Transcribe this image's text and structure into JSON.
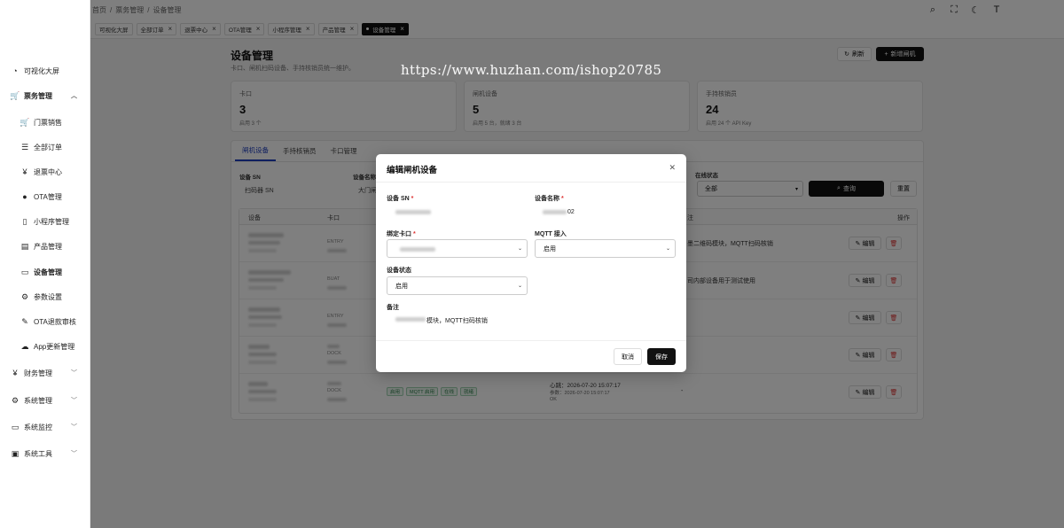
{
  "colors": {
    "accent": "#111111",
    "tab_active": "#1f3fbf",
    "badge_green": "#2e7d4a",
    "danger": "#dd3333"
  },
  "sidebar": {
    "items": [
      {
        "label": "可视化大屏",
        "icon": "dashboard-icon"
      },
      {
        "label": "票务管理",
        "icon": "cart-icon"
      },
      {
        "label": "门票销售",
        "icon": "cart-icon"
      },
      {
        "label": "全部订单",
        "icon": "list-icon"
      },
      {
        "label": "退票中心",
        "icon": "yen-icon"
      },
      {
        "label": "OTA管理",
        "icon": "globe-icon"
      },
      {
        "label": "小程序管理",
        "icon": "phone-icon"
      },
      {
        "label": "产品管理",
        "icon": "file-icon"
      },
      {
        "label": "设备管理",
        "icon": "monitor-icon"
      },
      {
        "label": "参数设置",
        "icon": "gear-icon"
      },
      {
        "label": "OTA退款审核",
        "icon": "edit-icon"
      },
      {
        "label": "App更新管理",
        "icon": "cloud-icon"
      },
      {
        "label": "财务管理",
        "icon": "yen-icon"
      },
      {
        "label": "系统管理",
        "icon": "gear-icon"
      },
      {
        "label": "系统监控",
        "icon": "monitor-icon"
      },
      {
        "label": "系统工具",
        "icon": "toolbox-icon"
      }
    ]
  },
  "breadcrumb": {
    "home": "首页",
    "section": "票务管理",
    "page": "设备管理"
  },
  "tabs": [
    "可视化大屏",
    "全部订单",
    "退票中心",
    "OTA管理",
    "小程序管理",
    "产品管理",
    "设备管理"
  ],
  "page": {
    "title": "设备管理",
    "subtitle": "卡口、闸机扫码设备、手持核销员统一维护。",
    "refresh_label": "刷新",
    "add_label": "新增闸机"
  },
  "stats": [
    {
      "label": "卡口",
      "value": "3",
      "hint": "启用 3 个"
    },
    {
      "label": "闸机设备",
      "value": "5",
      "hint": "启用 5 台，就绪 3 台"
    },
    {
      "label": "手持核销员",
      "value": "24",
      "hint": "启用 24 个 API Key"
    }
  ],
  "content_tabs": [
    "闸机设备",
    "手持核销员",
    "卡口管理"
  ],
  "filters": {
    "sn_label": "设备 SN",
    "sn_placeholder": "扫码器 SN",
    "name_label": "设备名称",
    "name_placeholder": "大门闸",
    "status_label": "在线状态",
    "status_value": "全部",
    "query_label": "查询",
    "reset_label": "重置"
  },
  "table": {
    "headers": [
      "设备",
      "卡口",
      "注",
      "操作"
    ],
    "rows": [
      {
        "gate_code": "ENTRY",
        "note": "墨二维码模块，MQTT扫码核销"
      },
      {
        "gate_code": "BUAT",
        "note": "司内部设备用于测试使用"
      },
      {
        "gate_code": "ENTRY",
        "note": ""
      },
      {
        "gate_code": "DOCK",
        "note": ""
      },
      {
        "gate_code": "DOCK",
        "note": "-",
        "badges": [
          "启用",
          "MQTT 启用",
          "在线",
          "就绪"
        ],
        "heartbeat": "心跳：2026-07-20 15:07:17",
        "param": "参数：2026-07-20 15:07:17",
        "param_status": "OK"
      }
    ],
    "edit_label": "编辑"
  },
  "watermark": "https://www.huzhan.com/ishop20785",
  "modal": {
    "title": "编辑闸机设备",
    "sn_label": "设备 SN",
    "name_label": "设备名称",
    "name_suffix": "02",
    "gate_label": "绑定卡口",
    "mqtt_label": "MQTT 接入",
    "mqtt_value": "启用",
    "status_label": "设备状态",
    "status_value": "启用",
    "note_label": "备注",
    "note_value": "模块，MQTT扫码核销",
    "cancel_label": "取消",
    "save_label": "保存"
  }
}
